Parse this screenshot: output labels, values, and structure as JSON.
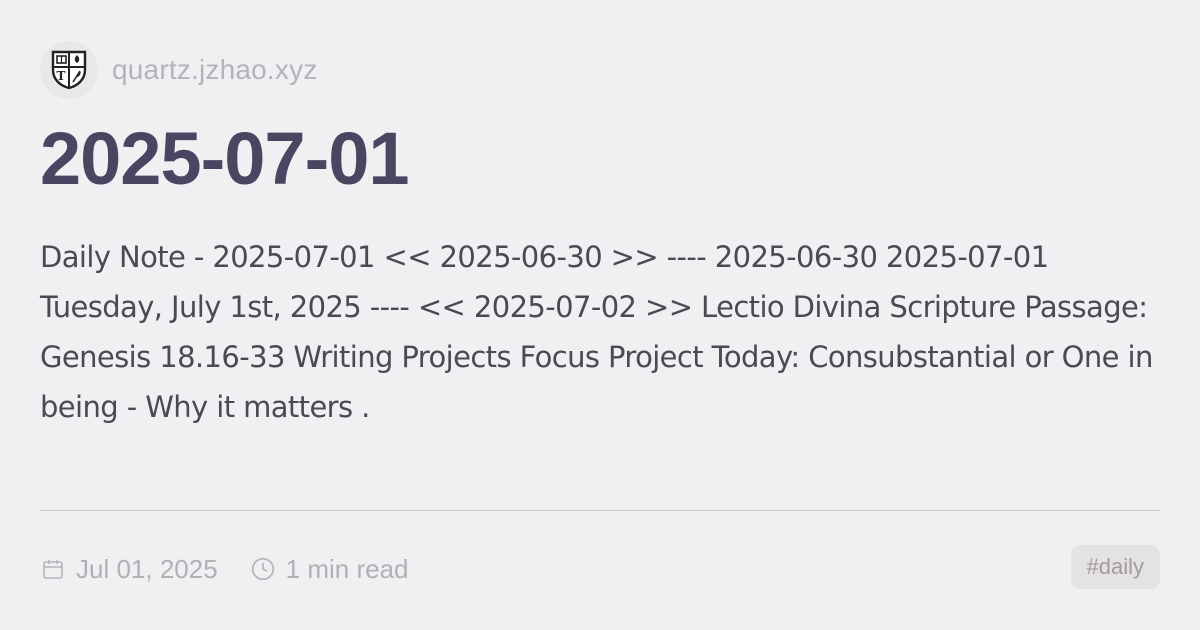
{
  "site": {
    "url": "quartz.jzhao.xyz",
    "logo_icon": "shield-crest-icon"
  },
  "page": {
    "title": "2025-07-01",
    "description": "Daily Note - 2025-07-01 << 2025-06-30 >> ---- 2025-06-30 2025-07-01 Tuesday, July 1st, 2025 ---- << 2025-07-02 >> Lectio Divina Scripture Passage: Genesis 18.16-33 Writing Projects Focus Project Today: Consubstantial or One in being - Why it matters ."
  },
  "meta": {
    "date": "Jul 01, 2025",
    "date_icon": "calendar-icon",
    "read_time": "1 min read",
    "read_time_icon": "clock-icon"
  },
  "tags": [
    "#daily"
  ],
  "colors": {
    "background": "#f0f0f3",
    "title": "#4a4662",
    "text": "#4a4a52",
    "muted": "#b0b0b5",
    "tag_bg": "#e3e3e6",
    "tag_text": "#a69a98"
  }
}
